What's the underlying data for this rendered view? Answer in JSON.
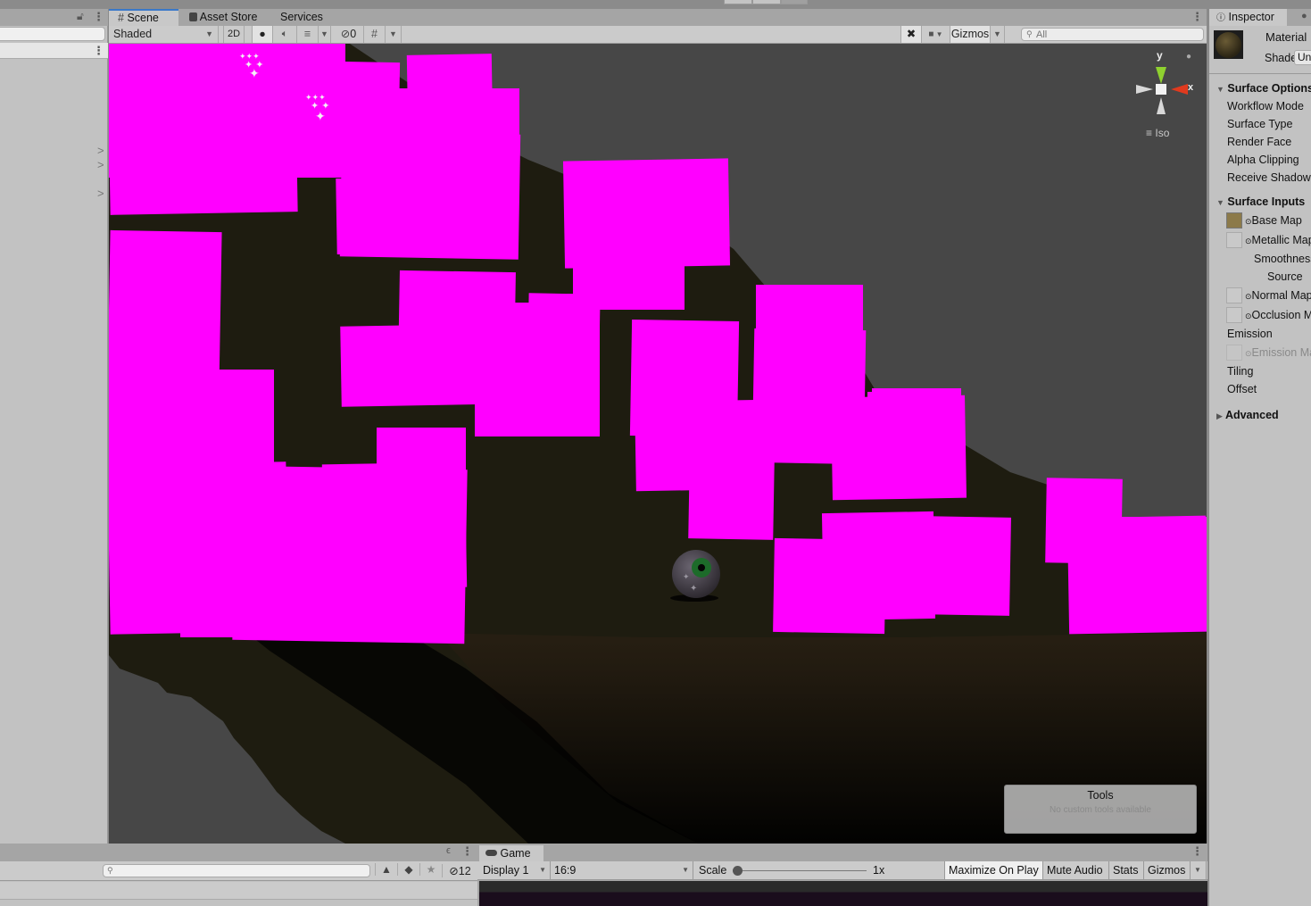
{
  "hierarchy": {
    "lock_icon": "lock-icon",
    "menu_icon": "kebab-menu-icon",
    "search_placeholder": "",
    "expand_arrows": [
      ">",
      ">",
      ">"
    ]
  },
  "scene": {
    "tabs": [
      {
        "label": "Scene",
        "icon": "grid-icon",
        "active": true
      },
      {
        "label": "Asset Store",
        "icon": "bag-icon",
        "active": false
      },
      {
        "label": "Services",
        "icon": "",
        "active": false
      }
    ],
    "toolbar": {
      "shading_mode": "Shaded",
      "mode_2d": "2D",
      "hidden_count": "0",
      "gizmos_label": "Gizmos",
      "search_placeholder": "All"
    },
    "orientation_gizmo": {
      "y_label": "y",
      "x_label": "x",
      "projection": "Iso"
    },
    "tools_overlay": {
      "title": "Tools",
      "subtitle": "No custom tools available"
    },
    "colors": {
      "missing_material": "#ff00ff",
      "sky": "#474747",
      "terrain_dark": "#1f1d12",
      "ground_brown": "#2f2617"
    }
  },
  "inspector": {
    "tab_label": "Inspector",
    "object_name": "Material",
    "shader_label": "Shader",
    "shader_value": "Un",
    "sections": [
      {
        "title": "Surface Options",
        "expanded": true,
        "rows": [
          "Workflow Mode",
          "Surface Type",
          "Render Face",
          "Alpha Clipping",
          "Receive Shadows"
        ]
      },
      {
        "title": "Surface Inputs",
        "expanded": true,
        "rows": [
          {
            "label": "Base Map",
            "has_texture_slot": true,
            "swatch": "#8c7a4a"
          },
          {
            "label": "Metallic Map",
            "has_texture_slot": true
          },
          {
            "label": "Smoothness",
            "indent": 1
          },
          {
            "label": "Source",
            "indent": 2
          },
          {
            "label": "Normal Map",
            "has_texture_slot": true
          },
          {
            "label": "Occlusion Map",
            "has_texture_slot": true
          },
          {
            "label": "Emission"
          },
          {
            "label": "Emission Map",
            "has_texture_slot": true,
            "disabled": true
          },
          {
            "label": "Tiling"
          },
          {
            "label": "Offset"
          }
        ]
      },
      {
        "title": "Advanced",
        "expanded": false,
        "rows": []
      }
    ]
  },
  "project": {
    "search_placeholder": "",
    "hidden_count": "12"
  },
  "game": {
    "tab_label": "Game",
    "display": "Display 1",
    "aspect": "16:9",
    "scale_label": "Scale",
    "scale_value": "1x",
    "scale_fraction": 0,
    "buttons": [
      "Maximize On Play",
      "Mute Audio",
      "Stats",
      "Gizmos"
    ]
  }
}
